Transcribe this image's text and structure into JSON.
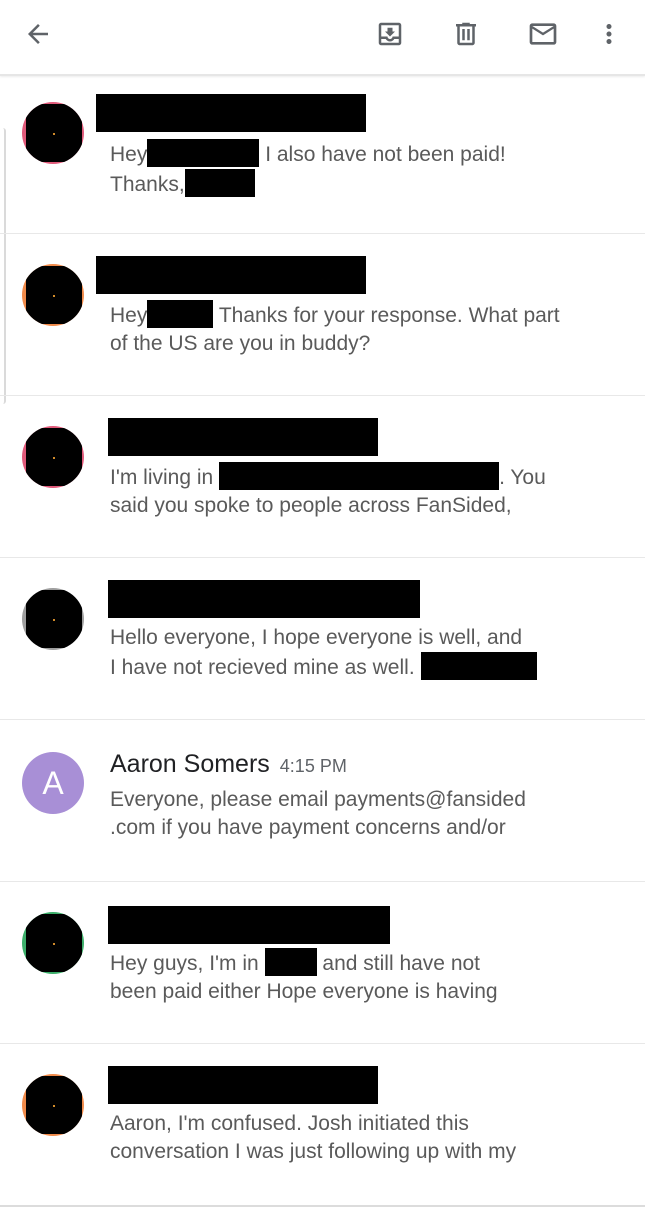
{
  "toolbar": {
    "back_icon": "arrow-back-icon",
    "archive_icon": "archive-icon",
    "delete_icon": "delete-icon",
    "mark_unread_icon": "mail-icon",
    "more_icon": "more-vert-icon"
  },
  "colors": {
    "avatar_aaron": "#a88fd6",
    "snippet_text": "#5a5a5a",
    "divider": "#e8e8e8"
  },
  "messages": [
    {
      "sender": "",
      "redacted_sender": true,
      "avatar_ring": "#e05a7a",
      "line1_pre": "Hey",
      "line1_post": " I also have not been paid!",
      "line2_pre": "Thanks,",
      "line2_post": ""
    },
    {
      "sender": "",
      "redacted_sender": true,
      "avatar_ring": "#f08a4a",
      "line1_pre": "Hey",
      "line1_post": " Thanks for your response. What part",
      "line2_pre": "of the US are you in buddy?",
      "line2_post": ""
    },
    {
      "sender": "",
      "redacted_sender": true,
      "avatar_ring": "#e05a7a",
      "line1_pre": "I'm living in",
      "line1_post": ". You",
      "line2_pre": "said you spoke to people across FanSided,",
      "line2_post": ""
    },
    {
      "sender": "",
      "redacted_sender": true,
      "avatar_ring": "#9e9e9e",
      "line1_pre": "Hello everyone, I hope everyone is well, and",
      "line1_post": "",
      "line2_pre": "I have not recieved mine as well.",
      "line2_post": ""
    },
    {
      "sender": "Aaron Somers",
      "time": "4:15 PM",
      "avatar_letter": "A",
      "line1_pre": "Everyone, please email payments@fansided",
      "line2_pre": ".com if you have payment concerns and/or"
    },
    {
      "sender": "",
      "redacted_sender": true,
      "avatar_ring": "#3cae6a",
      "line1_pre": "Hey guys, I'm in",
      "line1_post": " and still have not",
      "line2_pre": "been paid either Hope everyone is having",
      "line2_post": ""
    },
    {
      "sender": "",
      "redacted_sender": true,
      "avatar_ring": "#f08a4a",
      "line1_pre": "Aaron, I'm confused. Josh initiated this",
      "line1_post": "",
      "line2_pre": "conversation I was just following up with my",
      "line2_post": ""
    }
  ]
}
